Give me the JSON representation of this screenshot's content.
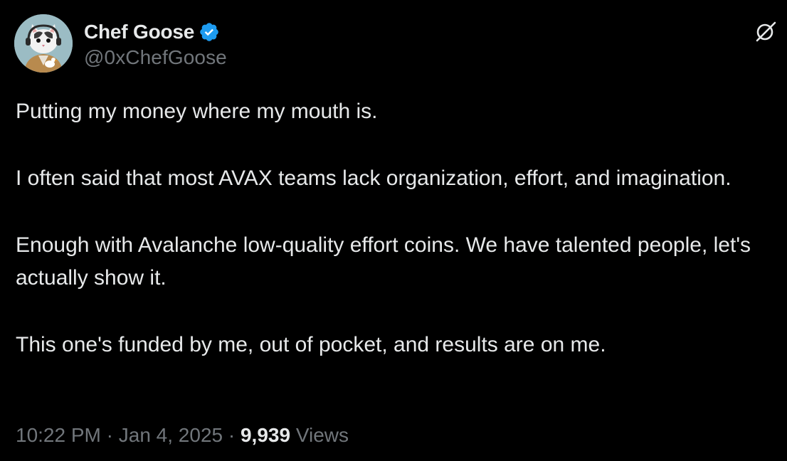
{
  "author": {
    "display_name": "Chef Goose",
    "handle": "@0xChefGoose",
    "avatar_icon": "cat-chef-avatar",
    "verified": true,
    "verified_color": "#1d9bf0"
  },
  "post": {
    "paragraphs": [
      "Putting my money where my mouth is.",
      "I often said that most AVAX teams lack organization, effort, and imagination.",
      "Enough with Avalanche low-quality effort coins. We have talented people, let's actually show it.",
      "This one's funded by me, out of pocket, and results are on me."
    ]
  },
  "meta": {
    "time": "10:22 PM",
    "separator": "·",
    "date": "Jan 4, 2025",
    "views_count": "9,939",
    "views_label": "Views"
  },
  "icons": {
    "top_right": "grok-icon"
  },
  "colors": {
    "background": "#000000",
    "primary_text": "#e7e9ea",
    "secondary_text": "#71767b",
    "accent": "#1d9bf0"
  }
}
